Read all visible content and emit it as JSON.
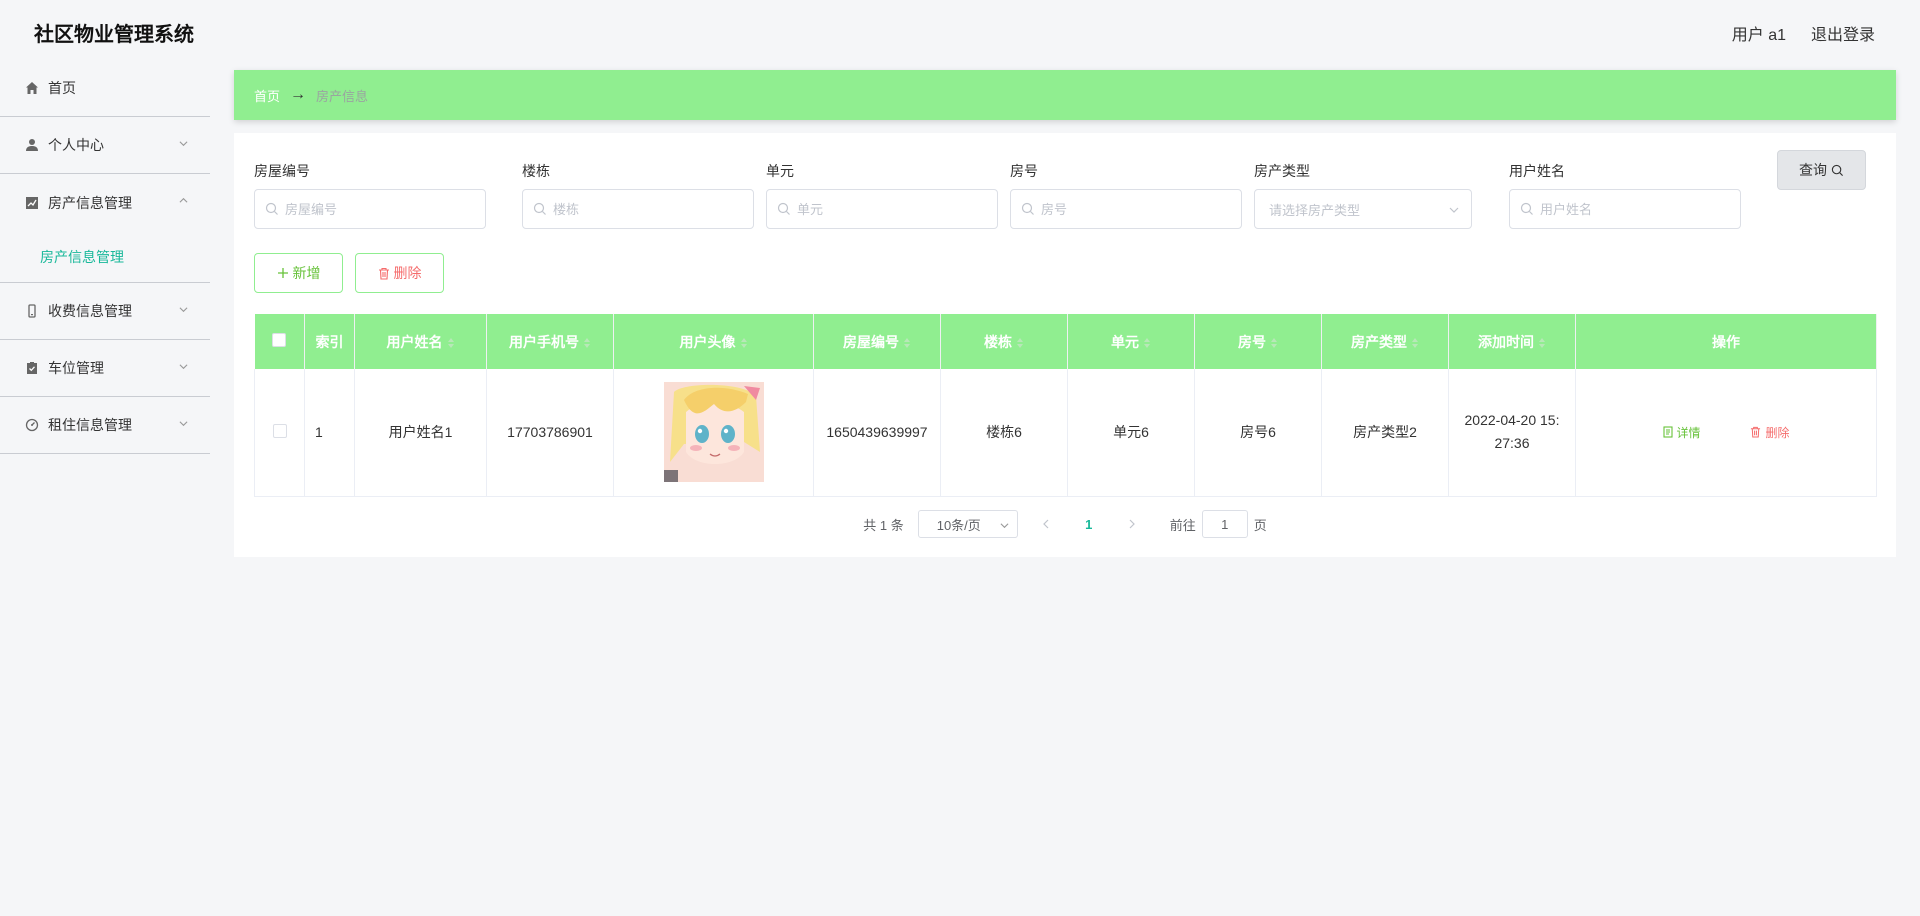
{
  "app": {
    "title": "社区物业管理系统",
    "user_label": "用户 a1",
    "logout_label": "退出登录"
  },
  "sidebar": {
    "items": [
      {
        "label": "首页",
        "icon": "home-icon"
      },
      {
        "label": "个人中心",
        "icon": "user-icon",
        "expanded": false
      },
      {
        "label": "房产信息管理",
        "icon": "chart-icon",
        "expanded": true
      },
      {
        "label": "收费信息管理",
        "icon": "phone-icon",
        "expanded": false
      },
      {
        "label": "车位管理",
        "icon": "clipboard-icon",
        "expanded": false
      },
      {
        "label": "租住信息管理",
        "icon": "gauge-icon",
        "expanded": false
      }
    ],
    "submenu": {
      "label": "房产信息管理"
    }
  },
  "breadcrumb": {
    "home": "首页",
    "arrow": "→",
    "current": "房产信息"
  },
  "search": {
    "house_no": {
      "label": "房屋编号",
      "placeholder": "房屋编号"
    },
    "building": {
      "label": "楼栋",
      "placeholder": "楼栋"
    },
    "unit": {
      "label": "单元",
      "placeholder": "单元"
    },
    "room": {
      "label": "房号",
      "placeholder": "房号"
    },
    "type": {
      "label": "房产类型",
      "placeholder": "请选择房产类型"
    },
    "user_name": {
      "label": "用户姓名",
      "placeholder": "用户姓名"
    },
    "query_label": "查询"
  },
  "actions": {
    "add_label": "新增",
    "delete_label": "删除"
  },
  "table": {
    "headers": [
      "索引",
      "用户姓名",
      "用户手机号",
      "用户头像",
      "房屋编号",
      "楼栋",
      "单元",
      "房号",
      "房产类型",
      "添加时间",
      "操作"
    ],
    "rows": [
      {
        "index": "1",
        "user_name": "用户姓名1",
        "phone": "17703786901",
        "house_no": "1650439639997",
        "building": "楼栋6",
        "unit": "单元6",
        "room": "房号6",
        "type": "房产类型2",
        "added_time": "2022-04-20 15:27:36",
        "detail_label": "详情",
        "delete_label": "删除"
      }
    ]
  },
  "pagination": {
    "total_text": "共 1 条",
    "page_size": "10条/页",
    "current_page": "1",
    "goto_label": "前往",
    "goto_value": "1",
    "page_suffix": "页"
  },
  "colors": {
    "accent_green": "#90ee90",
    "link_teal": "#19b89a",
    "success": "#67c23a",
    "danger": "#f56c6c"
  }
}
